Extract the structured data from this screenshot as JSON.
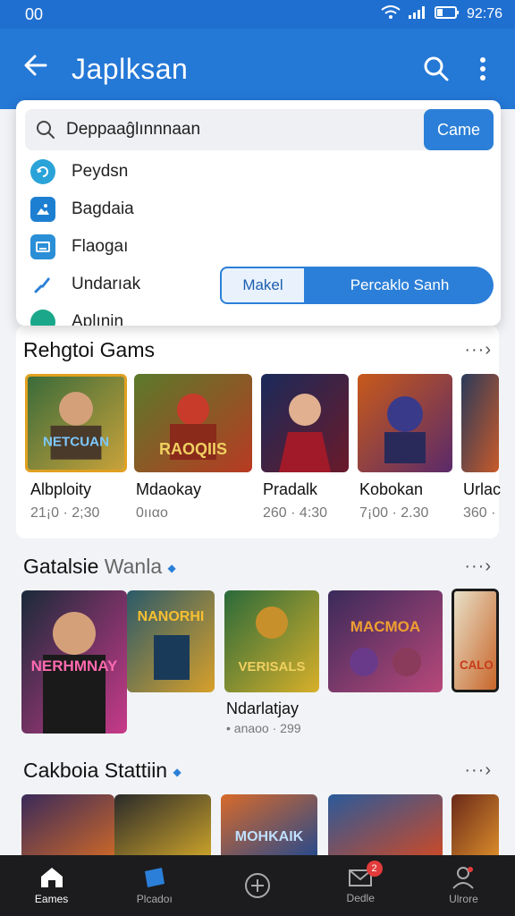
{
  "status": {
    "left": "00",
    "time": "92:76"
  },
  "appbar": {
    "title": "Japlksan"
  },
  "search": {
    "query": "Deppaaĝlınnnaan",
    "game_button": "Came"
  },
  "suggestions": [
    {
      "label": "Peydsn",
      "icon": "refresh-icon",
      "color": "#2aa3d8"
    },
    {
      "label": "Bagdaia",
      "icon": "image-icon",
      "color": "#1d7fd1"
    },
    {
      "label": "Flaogaı",
      "icon": "tv-icon",
      "color": "#2a8fd6"
    },
    {
      "label": "Undarıak",
      "icon": "brush-icon",
      "color": "#2b7fd8"
    },
    {
      "label": "Aplınin",
      "icon": "app-icon",
      "color": "#1ba88a"
    }
  ],
  "pills": {
    "first": "Makel",
    "second": "Percaklo Sanh"
  },
  "section1": {
    "title": "Rehgtoi Gams",
    "more": "···›",
    "games": [
      {
        "name": "Albploity",
        "meta": "21¡0 · 2;30",
        "art": "NETCUAN",
        "colors": [
          "#3a6b3a",
          "#c8a23a"
        ]
      },
      {
        "name": "Mdaokay",
        "meta": "0ııαo",
        "art": "RAOQIIS",
        "colors": [
          "#5a7a2a",
          "#b83a22"
        ]
      },
      {
        "name": "Pradalk",
        "meta": "260 · 4:30",
        "art": "",
        "colors": [
          "#1a2a5a",
          "#6a1a2a"
        ]
      },
      {
        "name": "Kobokan",
        "meta": "7¡00 · 2.30",
        "art": "",
        "colors": [
          "#c85a1a",
          "#5a2a6a"
        ]
      },
      {
        "name": "Urlac",
        "meta": "360 ·",
        "art": "",
        "colors": [
          "#2a3a5a",
          "#c85a2a"
        ]
      }
    ]
  },
  "section2": {
    "title": "Gatalsie",
    "title_muted": " Wanla",
    "more": "···›",
    "games": [
      {
        "art": "NERHMNAY",
        "colors": [
          "#1a2a3a",
          "#c83a8a"
        ]
      },
      {
        "art": "NANORHI",
        "colors": [
          "#2a5a6a",
          "#d8a02a"
        ]
      },
      {
        "art": "VERISALS",
        "colors": [
          "#2a6a3a",
          "#d8b02a"
        ]
      },
      {
        "art": "MACMOA",
        "colors": [
          "#3a2a5a",
          "#b8487a"
        ]
      },
      {
        "art": "CALO",
        "colors": [
          "#e8e0c8",
          "#c8662a"
        ]
      }
    ],
    "featured_name": "Ndarlatjay",
    "featured_meta": "• anaoo · 299"
  },
  "section3": {
    "title": "Cakboia Stattiin",
    "more": "···›",
    "games": [
      {
        "art": "",
        "colors": [
          "#3a2a5a",
          "#c8662a"
        ]
      },
      {
        "art": "",
        "colors": [
          "#2a2a2a",
          "#c8a02a"
        ]
      },
      {
        "art": "MOHKAIK",
        "colors": [
          "#d86a2a",
          "#2a4a8a"
        ]
      },
      {
        "art": "",
        "colors": [
          "#2a5a9a",
          "#c84a2a"
        ]
      },
      {
        "art": "",
        "colors": [
          "#6a2a1a",
          "#d88a2a"
        ]
      }
    ]
  },
  "nav": [
    {
      "label": "Eames",
      "icon": "home-icon"
    },
    {
      "label": "Plcadoı",
      "icon": "library-icon"
    },
    {
      "label": "",
      "icon": "add-icon"
    },
    {
      "label": "Dedle",
      "icon": "mail-icon",
      "badge": "2"
    },
    {
      "label": "Ulrore",
      "icon": "profile-icon"
    }
  ]
}
